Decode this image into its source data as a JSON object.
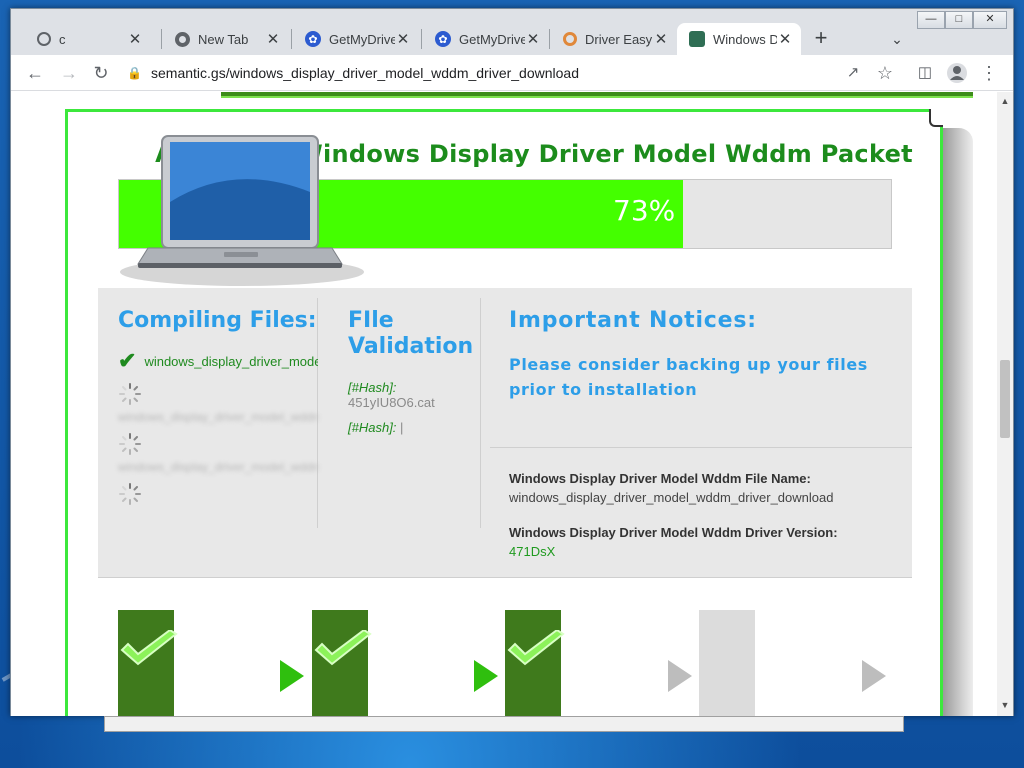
{
  "tabs": [
    {
      "label": "c",
      "icon": "globe-icon",
      "active": false
    },
    {
      "label": "New Tab",
      "icon": "chrome-icon",
      "active": false
    },
    {
      "label": "GetMyDrive",
      "icon": "getmydrivers-icon",
      "active": false
    },
    {
      "label": "GetMyDrive",
      "icon": "getmydrivers-icon",
      "active": false
    },
    {
      "label": "Driver Easy",
      "icon": "drivereasy-icon",
      "active": false
    },
    {
      "label": "Windows Di",
      "icon": "site-icon",
      "active": true
    }
  ],
  "toolbar": {
    "url": "semantic.gs/windows_display_driver_model_wddm_driver_download"
  },
  "page": {
    "title": "Assemble Windows Display Driver Model Wddm Packet",
    "progress_pct": 73,
    "progress_label": "73%",
    "compiling_heading": "Compiling Files:",
    "compiled_file": "windows_display_driver_model_wddm",
    "blurred_file_1": "windows_display_driver_model_wddm",
    "blurred_file_2": "windows_display_driver_model_wddm",
    "validation_heading": "FIle Validation",
    "hash_label_1": "[#Hash]:",
    "hash_value_1": "451yIU8O6.cat",
    "hash_label_2": "[#Hash]:",
    "hash_value_2": "|",
    "notices_heading": "Important Notices:",
    "notices_text": "Please consider backing up your files prior to installation",
    "file_name_label": "Windows Display Driver Model Wddm File Name:",
    "file_name_value": "windows_display_driver_model_wddm_driver_download",
    "version_label": "Windows Display Driver Model Wddm Driver Version:",
    "version_value": "471DsX"
  },
  "steps": [
    {
      "state": "done"
    },
    {
      "state": "done"
    },
    {
      "state": "done"
    },
    {
      "state": "pending"
    }
  ],
  "colors": {
    "accent_green": "#44ff00",
    "title_green": "#1c8c1c",
    "heading_blue": "#2d9ee8",
    "step_done": "#3f7a1c"
  }
}
